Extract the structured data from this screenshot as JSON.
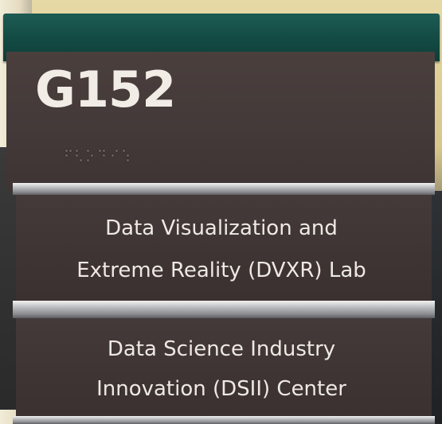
{
  "sign": {
    "room_number": "G152",
    "lab": {
      "line1": "Data Visualization and",
      "line2": "Extreme Reality (DVXR) Lab"
    },
    "center": {
      "line1": "Data Science Industry",
      "line2": "Innovation (DSII) Center"
    }
  },
  "colors": {
    "cap": "#134a43",
    "panel": "#433938",
    "text": "#ede9e3",
    "rail": "#b8b9bb"
  }
}
